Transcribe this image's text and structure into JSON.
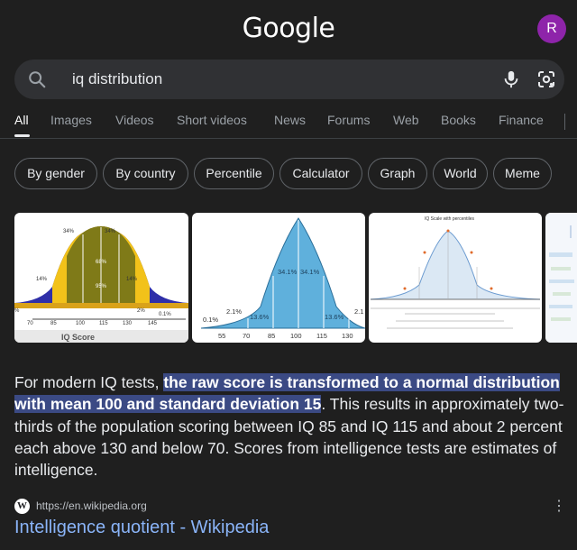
{
  "header": {
    "logo_text": "Google",
    "avatar_letter": "R",
    "avatar_color": "#8e24aa"
  },
  "search": {
    "query": "iq distribution"
  },
  "tabs": [
    {
      "label": "All",
      "active": true
    },
    {
      "label": "Images"
    },
    {
      "label": "Videos"
    },
    {
      "label": "Short videos"
    },
    {
      "label": "News"
    },
    {
      "label": "Forums"
    },
    {
      "label": "Web"
    },
    {
      "label": "Books"
    },
    {
      "label": "Finance"
    }
  ],
  "chips": [
    "By gender",
    "By country",
    "Percentile",
    "Calculator",
    "Graph",
    "World",
    "Meme"
  ],
  "images": {
    "img1": {
      "caption": "IQ Score",
      "pct_labels": [
        "34%",
        "34%",
        "14%",
        "14%",
        "68%",
        "2%",
        "95%",
        "0.1%",
        "%"
      ],
      "ticks": [
        "70",
        "85",
        "100",
        "115",
        "130",
        "145"
      ]
    },
    "img2": {
      "pct_labels": [
        "34.1%",
        "34.1%",
        "13.6%",
        "13.6%",
        "2.1%",
        "2.1",
        "0.1%"
      ],
      "ticks": [
        "55",
        "70",
        "85",
        "100",
        "115",
        "130"
      ]
    },
    "img3": {
      "title": "IQ Scale with percentiles"
    }
  },
  "snippet": {
    "before": "For modern IQ tests, ",
    "highlight": "the raw score is transformed to a normal distribution with mean 100 and standard deviation 15",
    "after": ". This results in approximately two-thirds of the population scoring between IQ 85 and IQ 115 and about 2 percent each above 130 and below 70. Scores from intelligence tests are estimates of intelligence."
  },
  "result": {
    "favicon_letter": "W",
    "url": "https://en.wikipedia.org",
    "title": "Intelligence quotient - Wikipedia"
  },
  "colors": {
    "background": "#1f1f1f",
    "link": "#8ab4f8",
    "highlight": "#3b4a84"
  }
}
